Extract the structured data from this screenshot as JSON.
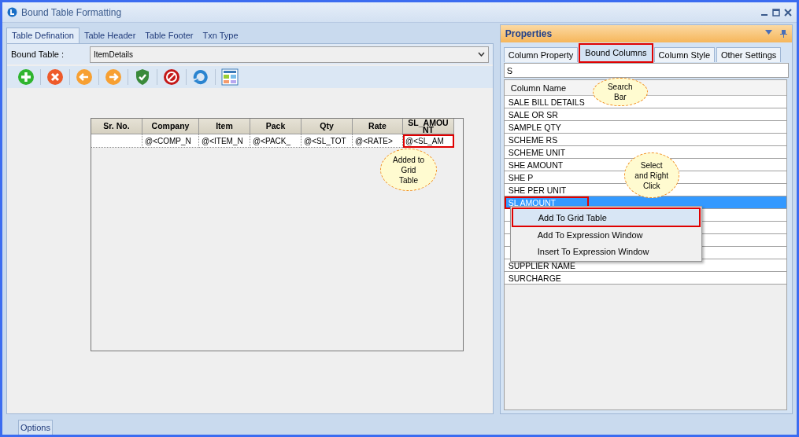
{
  "window": {
    "title": "Bound Table Formatting"
  },
  "left_tabs": [
    {
      "label": "Table Defination",
      "selected": true
    },
    {
      "label": "Table Header",
      "selected": false
    },
    {
      "label": "Table Footer",
      "selected": false
    },
    {
      "label": "Txn Type",
      "selected": false
    }
  ],
  "bound_table": {
    "label": "Bound Table :",
    "value": "ItemDetails"
  },
  "grid": {
    "columns": [
      "Sr. No.",
      "Company",
      "Item",
      "Pack",
      "Qty",
      "Rate",
      "SL_AMOU\nNT"
    ],
    "cells": [
      {
        "text": "",
        "highlighted": false
      },
      {
        "text": "@<COMP_N",
        "highlighted": false
      },
      {
        "text": "@<ITEM_N",
        "highlighted": false
      },
      {
        "text": "@<PACK_",
        "highlighted": false
      },
      {
        "text": "@<SL_TOT",
        "highlighted": false
      },
      {
        "text": "@<RATE>",
        "highlighted": false
      },
      {
        "text": "@<SL_AM",
        "highlighted": true
      }
    ]
  },
  "callouts": [
    {
      "text": "Added to\nGrid\nTable",
      "kind": "grid"
    },
    {
      "text": "Search\nBar",
      "kind": "search"
    },
    {
      "text": "Select\nand Right\nClick",
      "kind": "list"
    }
  ],
  "properties": {
    "title": "Properties",
    "tabs": [
      {
        "label": "Column Property",
        "selected": false,
        "highlighted": false
      },
      {
        "label": "Bound Columns",
        "selected": true,
        "highlighted": true
      },
      {
        "label": "Column Style",
        "selected": false,
        "highlighted": false
      },
      {
        "label": "Other Settings",
        "selected": false,
        "highlighted": false
      }
    ],
    "search": {
      "value": "S"
    },
    "list_header": "Column Name",
    "items": [
      {
        "text": "SALE BILL DETAILS",
        "selected": false,
        "highlighted": false
      },
      {
        "text": "SALE OR SR",
        "selected": false,
        "highlighted": false
      },
      {
        "text": "SAMPLE QTY",
        "selected": false,
        "highlighted": false
      },
      {
        "text": "SCHEME RS",
        "selected": false,
        "highlighted": false
      },
      {
        "text": "SCHEME UNIT",
        "selected": false,
        "highlighted": false
      },
      {
        "text": "SHE AMOUNT",
        "selected": false,
        "highlighted": false
      },
      {
        "text": "SHE P",
        "selected": false,
        "highlighted": false
      },
      {
        "text": "SHE PER UNIT",
        "selected": false,
        "highlighted": false
      },
      {
        "text": "SL AMOUNT",
        "selected": true,
        "highlighted": true
      },
      {
        "selected": false,
        "highlighted": false
      },
      {
        "selected": false,
        "highlighted": false
      },
      {
        "selected": false,
        "highlighted": false
      },
      {
        "selected": false,
        "highlighted": false
      },
      {
        "text": "SUPPLIER NAME",
        "selected": false,
        "highlighted": false
      },
      {
        "text": "SURCHARGE",
        "selected": false,
        "highlighted": false
      }
    ],
    "context_menu": [
      {
        "label": "Add To Grid Table",
        "highlighted": true
      },
      {
        "label": "Add To Expression Window",
        "highlighted": false
      },
      {
        "label": "Insert To Expression Window",
        "highlighted": false
      }
    ]
  },
  "bottom_tabs": [
    {
      "label": "Options"
    }
  ]
}
